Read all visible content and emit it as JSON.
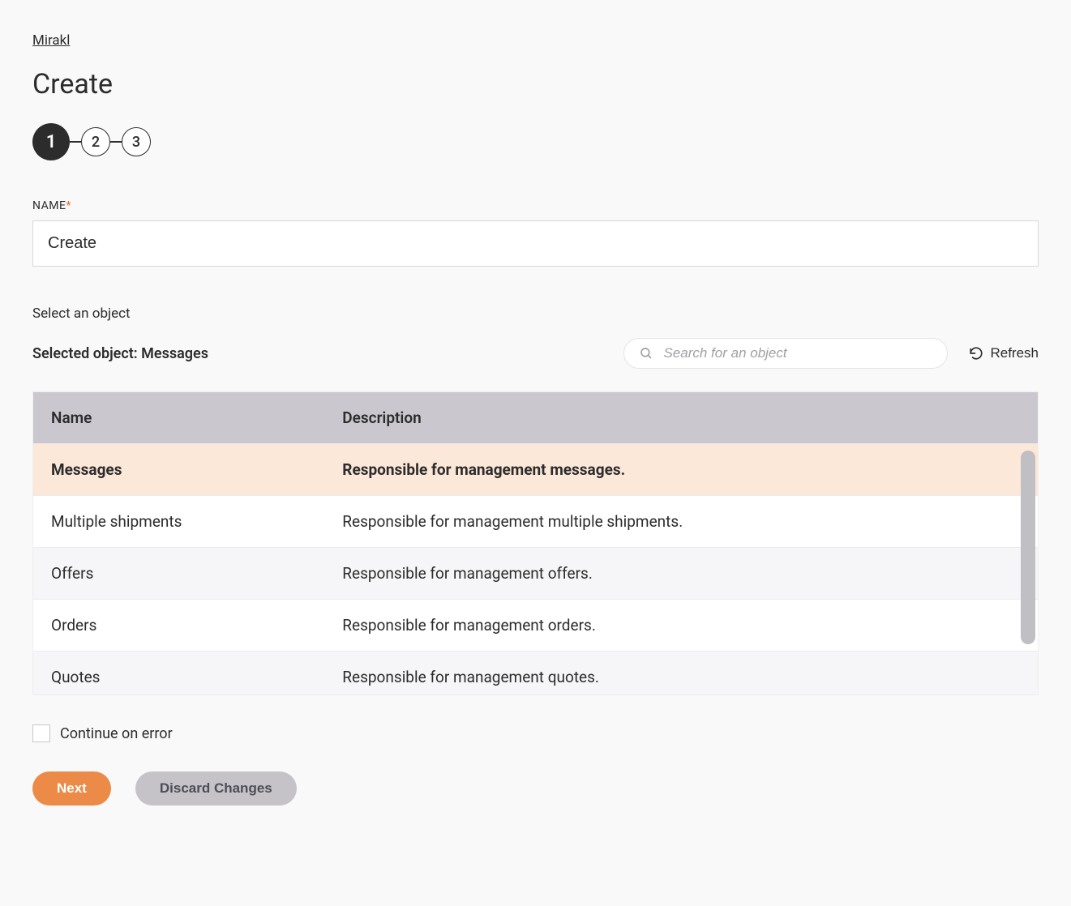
{
  "breadcrumb": "Mirakl",
  "page_title": "Create",
  "stepper": {
    "steps": [
      "1",
      "2",
      "3"
    ],
    "active_index": 0
  },
  "name_field": {
    "label": "NAME",
    "required_mark": "*",
    "value": "Create"
  },
  "object_section": {
    "hint": "Select an object",
    "selected_prefix": "Selected object: ",
    "selected_value": "Messages",
    "search_placeholder": "Search for an object",
    "refresh_label": "Refresh"
  },
  "table": {
    "headers": {
      "name": "Name",
      "description": "Description"
    },
    "rows": [
      {
        "name": "Messages",
        "description": "Responsible for management messages.",
        "selected": true
      },
      {
        "name": "Multiple shipments",
        "description": "Responsible for management multiple shipments.",
        "selected": false
      },
      {
        "name": "Offers",
        "description": "Responsible for management offers.",
        "selected": false
      },
      {
        "name": "Orders",
        "description": "Responsible for management orders.",
        "selected": false
      },
      {
        "name": "Quotes",
        "description": "Responsible for management quotes.",
        "selected": false
      }
    ]
  },
  "continue_on_error": {
    "label": "Continue on error",
    "checked": false
  },
  "buttons": {
    "next": "Next",
    "discard": "Discard Changes"
  }
}
